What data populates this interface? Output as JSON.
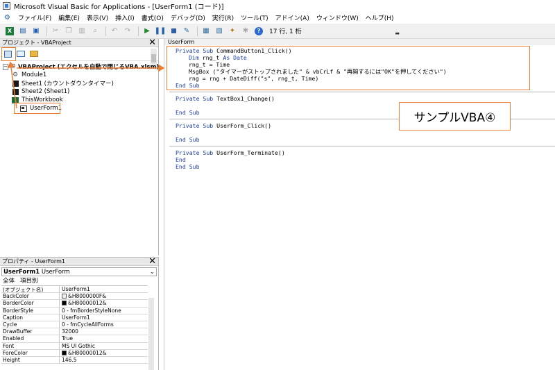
{
  "window": {
    "title": "Microsoft Visual Basic for Applications - [UserForm1 (コード)]"
  },
  "menu": [
    "ファイル(F)",
    "編集(E)",
    "表示(V)",
    "挿入(I)",
    "書式(O)",
    "デバッグ(D)",
    "実行(R)",
    "ツール(T)",
    "アドイン(A)",
    "ウィンドウ(W)",
    "ヘルプ(H)"
  ],
  "toolbar": {
    "position_label": "17 行, 1 桁"
  },
  "project": {
    "header": "プロジェクト - VBAProject",
    "root": "VBAProject (エクセルを自動で閉じるVBA.xlsm)",
    "items": [
      "Module1",
      "Sheet1 (カウントダウンタイマー)",
      "Sheet2 (Sheet1)",
      "ThisWorkbook",
      "UserForm1"
    ]
  },
  "properties": {
    "header": "プロパティ - UserForm1",
    "object_name": "UserForm1",
    "object_type": "UserForm",
    "tabs": [
      "全体",
      "項目別"
    ],
    "rows": [
      {
        "name": "(オブジェクト名)",
        "value": "UserForm1"
      },
      {
        "name": "BackColor",
        "value": "&H8000000F&"
      },
      {
        "name": "BorderColor",
        "value": "&H80000012&"
      },
      {
        "name": "BorderStyle",
        "value": "0 - fmBorderStyleNone"
      },
      {
        "name": "Caption",
        "value": "UserForm1"
      },
      {
        "name": "Cycle",
        "value": "0 - fmCycleAllForms"
      },
      {
        "name": "DrawBuffer",
        "value": "32000"
      },
      {
        "name": "Enabled",
        "value": "True"
      },
      {
        "name": "Font",
        "value": "MS UI Gothic"
      },
      {
        "name": "ForeColor",
        "value": "&H80000012&"
      },
      {
        "name": "Height",
        "value": "146.5"
      }
    ]
  },
  "code": {
    "object_dropdown": "UserForm",
    "proc1": {
      "l1_kw": "Private Sub",
      "l1_rest": " CommandButton1_Click()",
      "l2_kw": "Dim",
      "l2_mid": " rng_t ",
      "l2_kw2": "As Date",
      "l3": "rng_t = Time",
      "l4": "MsgBox (\"タイマーがストップされました\" & vbCrLf & \"再開するには\"OK\"を押してください\")",
      "l5": "rng = rng + DateDiff(\"s\", rng_t, Time)",
      "l6": "End Sub"
    },
    "proc2": {
      "l1_kw": "Private Sub",
      "l1_rest": " TextBox1_Change()",
      "end": "End Sub"
    },
    "proc3": {
      "l1_kw": "Private Sub",
      "l1_rest": " UserForm_Click()",
      "end": "End Sub"
    },
    "proc4": {
      "l1_kw": "Private Sub",
      "l1_rest": " UserForm_Terminate()",
      "l2": "End",
      "end": "End Sub"
    }
  },
  "annotation": {
    "label": "サンプルVBA④",
    "color": "#ed7d31"
  }
}
